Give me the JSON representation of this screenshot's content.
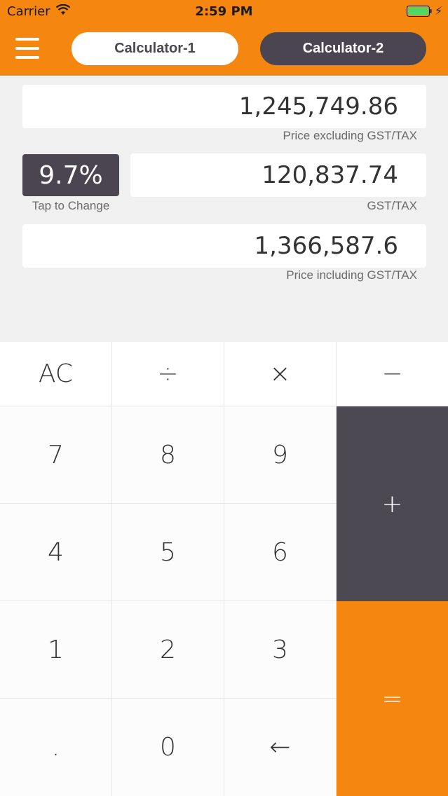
{
  "status_bar": {
    "carrier": "Carrier",
    "time": "2:59 PM",
    "wifi_icon": "wifi-icon",
    "battery_icon": "battery-icon"
  },
  "header": {
    "menu_icon": "hamburger-menu-icon",
    "tabs": [
      {
        "label": "Calculator-1",
        "active": false
      },
      {
        "label": "Calculator-2",
        "active": true
      }
    ]
  },
  "display": {
    "price_excluding": {
      "value": "1,245,749.86",
      "label": "Price excluding GST/TAX"
    },
    "gst": {
      "value": "120,837.74",
      "label": "GST/TAX"
    },
    "price_including": {
      "value": "1,366,587.6",
      "label": "Price including GST/TAX"
    },
    "rate": {
      "value": "9.7%",
      "hint": "Tap to Change"
    }
  },
  "keypad": {
    "clear": "AC",
    "divide": "÷",
    "multiply": "×",
    "minus": "−",
    "seven": "7",
    "eight": "8",
    "nine": "9",
    "plus": "+",
    "four": "4",
    "five": "5",
    "six": "6",
    "one": "1",
    "two": "2",
    "three": "3",
    "equals": "=",
    "decimal": ".",
    "zero": "0",
    "backspace": "←"
  },
  "colors": {
    "accent": "#f5860f",
    "dark": "#4a4550",
    "background": "#f0f0f0"
  }
}
